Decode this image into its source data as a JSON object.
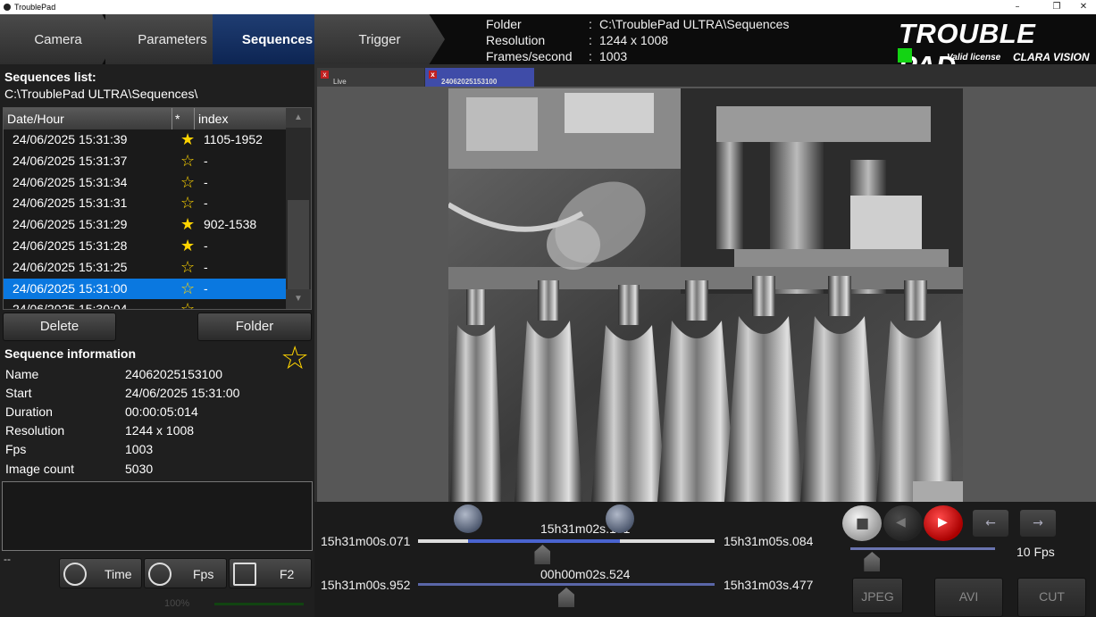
{
  "window": {
    "title": "TroublePad",
    "minimize": "–",
    "restore": "❐",
    "close": "✕"
  },
  "nav_tabs": [
    {
      "label": "Camera",
      "active": false
    },
    {
      "label": "Parameters",
      "active": false
    },
    {
      "label": "Sequences",
      "active": true
    },
    {
      "label": "Trigger",
      "active": false
    }
  ],
  "header_info": {
    "folder_label": "Folder",
    "folder_value": "C:\\TroublePad ULTRA\\Sequences",
    "resolution_label": "Resolution",
    "resolution_value": "1244 x 1008",
    "fps_label": "Frames/second",
    "fps_value": "1003",
    "colon": ":"
  },
  "brand": {
    "name": "TROUBLE PAD",
    "license": "Valid license",
    "company": "CLARA VISION",
    "license_color": "#13d313"
  },
  "sequences": {
    "title": "Sequences list:",
    "path": "C:\\TroublePad ULTRA\\Sequences\\",
    "columns": [
      "Date/Hour",
      "*",
      "index"
    ],
    "rows": [
      {
        "date": "24/06/2025 15:31:39",
        "star": "★",
        "index": "1105-1952"
      },
      {
        "date": "24/06/2025 15:31:37",
        "star": "☆",
        "index": "-"
      },
      {
        "date": "24/06/2025 15:31:34",
        "star": "☆",
        "index": "-"
      },
      {
        "date": "24/06/2025 15:31:31",
        "star": "☆",
        "index": "-"
      },
      {
        "date": "24/06/2025 15:31:29",
        "star": "★",
        "index": "902-1538"
      },
      {
        "date": "24/06/2025 15:31:28",
        "star": "★",
        "index": "-"
      },
      {
        "date": "24/06/2025 15:31:25",
        "star": "☆",
        "index": "-"
      },
      {
        "date": "24/06/2025 15:31:00",
        "star": "☆",
        "index": "-"
      },
      {
        "date": "24/06/2025 15:30:04",
        "star": "☆",
        "index": ""
      }
    ],
    "selected_index": 7,
    "delete_label": "Delete",
    "folder_label": "Folder"
  },
  "sequence_info": {
    "title": "Sequence information",
    "star": "☆",
    "fields": [
      {
        "label": "Name",
        "value": "24062025153100"
      },
      {
        "label": "Start",
        "value": "24/06/2025 15:31:00"
      },
      {
        "label": "Duration",
        "value": "00:00:05:014"
      },
      {
        "label": "Resolution",
        "value": "1244 x 1008"
      },
      {
        "label": "Fps",
        "value": "1003"
      },
      {
        "label": "Image count",
        "value": "5030"
      }
    ]
  },
  "bottom_left": {
    "dash": "--",
    "time_label": "Time",
    "fps_label": "Fps",
    "f2_label": "F2",
    "zoom": "100%"
  },
  "viewer_tabs": [
    {
      "label": "Live",
      "active": false
    },
    {
      "label": "24062025153100",
      "active": true
    }
  ],
  "timeline": {
    "start": "15h31m00s.071",
    "current": "15h31m02s.181",
    "end": "15h31m05s.084",
    "sub_start": "15h31m00s.952",
    "sub_current": "00h00m02s.524",
    "sub_end": "15h31m03s.477",
    "selection_start_fraction": 0.17,
    "selection_end_fraction": 0.68,
    "playhead_fraction": 0.42,
    "sub_playhead_fraction": 0.5
  },
  "playback": {
    "stop_icon": "■",
    "prev_icon": "◀",
    "play_icon": "▶",
    "step_back_icon": "←",
    "step_fwd_icon": "→",
    "speed": "10 Fps",
    "speed_fraction": 0.15
  },
  "export": {
    "jpeg": "JPEG",
    "avi": "AVI",
    "cut": "CUT"
  },
  "colors": {
    "accent": "#0a78e0",
    "star": "#ffd400",
    "play": "#d01818",
    "range": "#4a64d0"
  }
}
